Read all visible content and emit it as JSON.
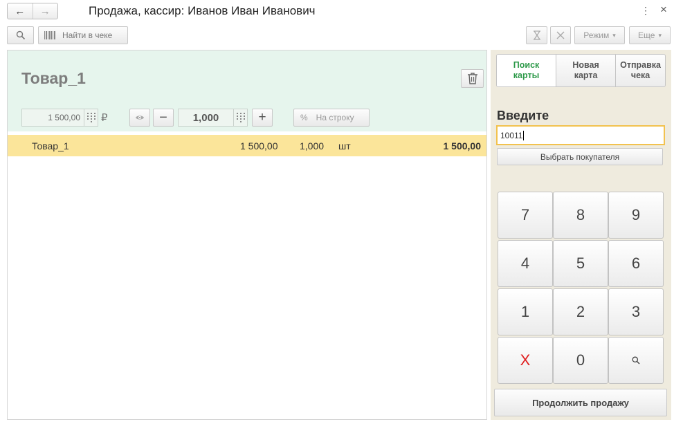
{
  "header": {
    "title": "Продажа, кассир: Иванов Иван Иванович",
    "back_icon": "←",
    "forward_icon": "→",
    "more_icon": "⋮",
    "close_icon": "×"
  },
  "toolbar": {
    "search_icon": "magnifier",
    "find_in_receipt_label": "Найти в чеке",
    "mode_label": "Режим",
    "more_label": "Еще",
    "dropdown_glyph": "▾"
  },
  "item_editor": {
    "product_name": "Товар_1",
    "price_value": "1 500,00",
    "currency_symbol": "₽",
    "quantity_value": "1,000",
    "minus_glyph": "−",
    "plus_glyph": "+",
    "percent_glyph": "%",
    "discount_placeholder": "На строку"
  },
  "receipt": {
    "rows": [
      {
        "name": "Товар_1",
        "price": "1 500,00",
        "quantity": "1,000",
        "unit": "шт",
        "sum": "1 500,00"
      }
    ]
  },
  "right_panel": {
    "tabs": [
      {
        "label": "Поиск карты",
        "active": true
      },
      {
        "label": "Новая карта",
        "active": false
      },
      {
        "label": "Отправка чека",
        "active": false
      }
    ],
    "enter_label": "Введите",
    "input_value": "10011",
    "choose_customer_label": "Выбрать покупателя",
    "keypad": [
      "7",
      "8",
      "9",
      "4",
      "5",
      "6",
      "1",
      "2",
      "3",
      "X",
      "0"
    ],
    "continue_label": "Продолжить продажу"
  },
  "colors": {
    "accent_green": "#2e9a4a",
    "editor_background": "#e6f5ed",
    "selected_row": "#fbe59a",
    "input_focus_border": "#f2c24e",
    "clear_key": "#e02020"
  }
}
